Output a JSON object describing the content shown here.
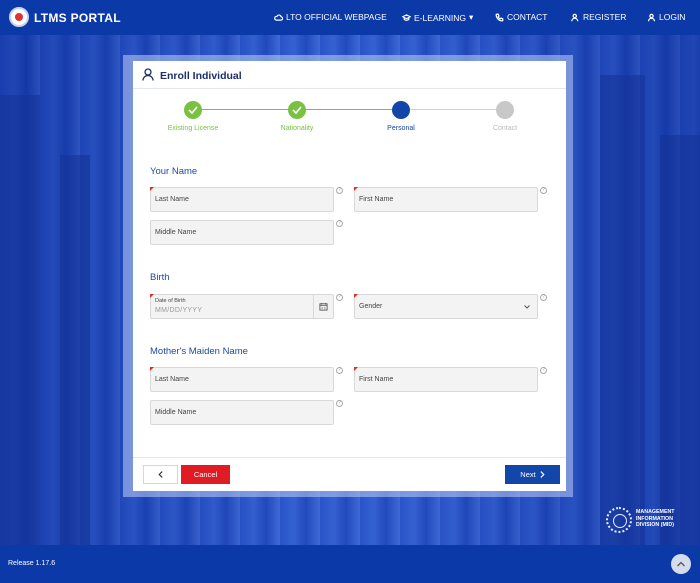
{
  "header": {
    "brand": "LTMS PORTAL",
    "nav": [
      {
        "label": "LTO OFFICIAL WEBPAGE",
        "icon": "cloud-icon"
      },
      {
        "label": "E-LEARNING",
        "icon": "graduation-cap-icon",
        "caret": "▾"
      },
      {
        "label": "CONTACT",
        "icon": "phone-icon"
      },
      {
        "label": "REGISTER",
        "icon": "user-plus-icon"
      },
      {
        "label": "LOGIN",
        "icon": "user-icon"
      }
    ]
  },
  "card": {
    "title": "Enroll Individual",
    "steps": [
      {
        "label": "Existing License",
        "state": "done"
      },
      {
        "label": "Nationality",
        "state": "done"
      },
      {
        "label": "Personal",
        "state": "active"
      },
      {
        "label": "Contact",
        "state": "pending"
      }
    ],
    "sections": {
      "your_name": {
        "title": "Your Name",
        "last_name": "Last Name",
        "first_name": "First Name",
        "middle_name": "Middle Name"
      },
      "birth": {
        "title": "Birth",
        "dob_label": "Date of Birth",
        "dob_placeholder": "MM/DD/YYYY",
        "gender": "Gender"
      },
      "maiden": {
        "title": "Mother's Maiden Name",
        "last_name": "Last Name",
        "first_name": "First Name",
        "middle_name": "Middle Name"
      }
    },
    "buttons": {
      "back": "‹",
      "cancel": "Cancel",
      "next": "Next"
    }
  },
  "mid_logo": {
    "line1": "MANAGEMENT",
    "line2": "INFORMATION",
    "line3": "DIVISION (MID)"
  },
  "footer": {
    "release": "Release 1.17.6"
  },
  "colors": {
    "primary": "#0b3aa8",
    "step_done": "#7ac142",
    "step_active": "#1246a8",
    "step_pending": "#c8c8c8",
    "cancel": "#e01b24"
  }
}
